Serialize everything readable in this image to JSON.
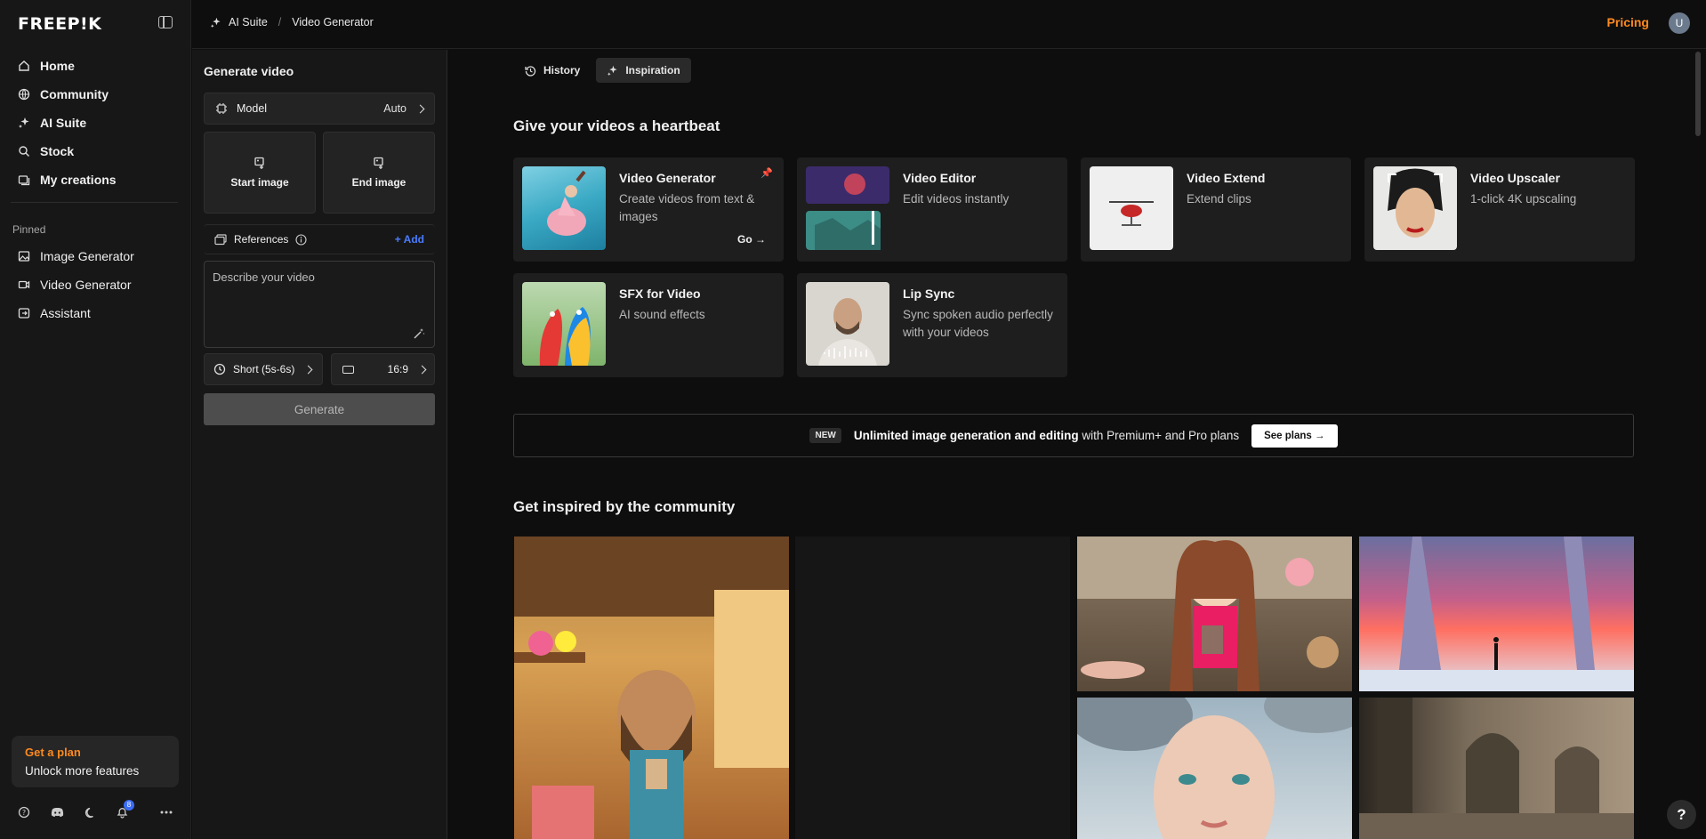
{
  "app": {
    "logo": "FREEP!K"
  },
  "sidebar": {
    "nav": [
      {
        "label": "Home",
        "icon": "home-icon"
      },
      {
        "label": "Community",
        "icon": "globe-icon"
      },
      {
        "label": "AI Suite",
        "icon": "sparkles-icon"
      },
      {
        "label": "Stock",
        "icon": "search-icon"
      },
      {
        "label": "My creations",
        "icon": "folder-icon"
      }
    ],
    "pinned_label": "Pinned",
    "pinned": [
      {
        "label": "Image Generator",
        "icon": "image-icon"
      },
      {
        "label": "Video Generator",
        "icon": "video-icon"
      },
      {
        "label": "Assistant",
        "icon": "assistant-icon"
      }
    ],
    "plan": {
      "title": "Get a plan",
      "subtitle": "Unlock more features"
    },
    "notifications_count": "8"
  },
  "topbar": {
    "breadcrumb": [
      "AI Suite",
      "Video Generator"
    ],
    "pricing": "Pricing",
    "avatar_initial": "U"
  },
  "generate": {
    "title": "Generate video",
    "model_label": "Model",
    "model_value": "Auto",
    "start_image": "Start image",
    "end_image": "End image",
    "references_label": "References",
    "add_label": "+ Add",
    "prompt_placeholder": "Describe your video",
    "duration": "Short (5s-6s)",
    "aspect": "16:9",
    "generate_label": "Generate"
  },
  "main": {
    "tabs": [
      {
        "label": "History"
      },
      {
        "label": "Inspiration"
      }
    ],
    "heading": "Give your videos a heartbeat",
    "tools": [
      {
        "title": "Video Generator",
        "desc": "Create videos from text & images",
        "cta": "Go"
      },
      {
        "title": "Video Editor",
        "desc": "Edit videos instantly"
      },
      {
        "title": "Video Extend",
        "desc": "Extend clips"
      },
      {
        "title": "Video Upscaler",
        "desc": "1-click 4K upscaling"
      },
      {
        "title": "SFX for Video",
        "desc": "AI sound effects"
      },
      {
        "title": "Lip Sync",
        "desc": "Sync spoken audio perfectly with your videos"
      }
    ],
    "promo": {
      "badge": "NEW",
      "bold": "Unlimited image generation and editing",
      "rest": "with Premium+ and Pro plans",
      "cta": "See plans"
    },
    "community_heading": "Get inspired by the community"
  },
  "colors": {
    "accent": "#ff8a1f",
    "link": "#4a7cff"
  }
}
